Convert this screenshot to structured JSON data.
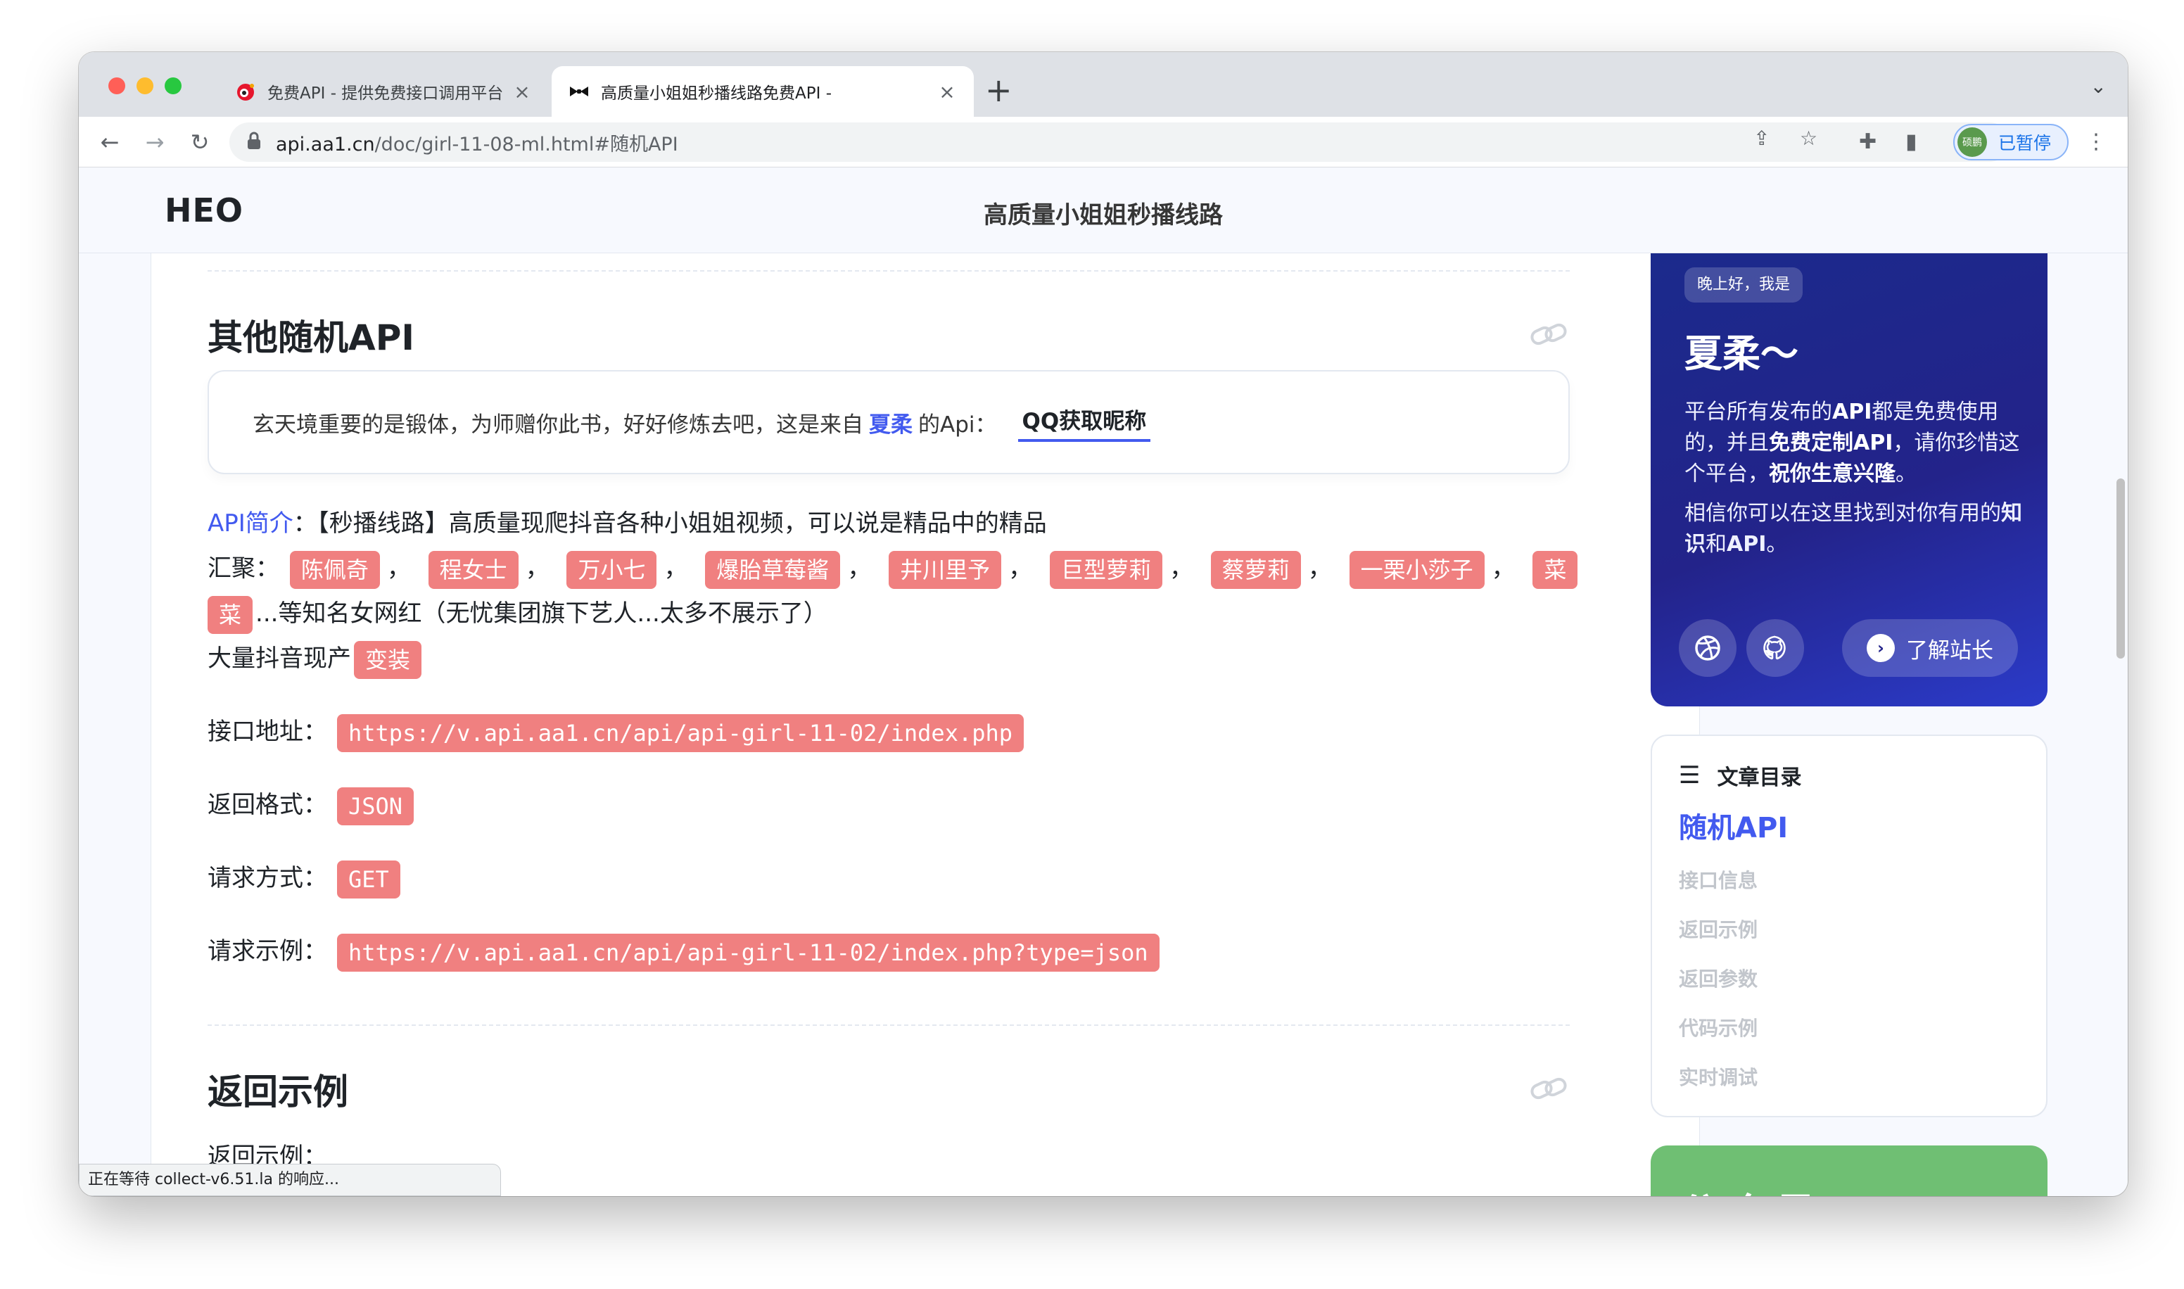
{
  "browser": {
    "tabs": [
      {
        "title": "免费API - 提供免费接口调用平台"
      },
      {
        "title": "高质量小姐姐秒播线路免费API -"
      }
    ],
    "url_host": "api.aa1.cn",
    "url_path": "/doc/girl-11-08-ml.html#随机API",
    "profile_avatar": "硕鹏",
    "profile_label": "已暂停",
    "status_text": "正在等待 collect-v6.51.la 的响应..."
  },
  "site": {
    "logo": "HEO",
    "title": "高质量小姐姐秒播线路"
  },
  "article": {
    "section1_title": "其他随机API",
    "quote": {
      "text": "玄天境重要的是锻体，为师赠你此书，好好修炼去吧，这是来自",
      "author": "夏柔",
      "suffix": "的Api：",
      "link": "QQ获取昵称"
    },
    "intro_label": "API简介",
    "intro_text": "：【秒播线路】高质量现爬抖音各种小姐姐视频，可以说是精品中的精品",
    "gather_label": "汇聚：",
    "tags": [
      "陈佩奇",
      "程女士",
      "万小七",
      "爆胎草莓酱",
      "井川里予",
      "巨型萝莉",
      "蔡萝莉",
      "一栗小莎子",
      "菜"
    ],
    "tag_cont": "菜",
    "gather_suffix": "...等知名女网红（无忧集团旗下艺人...太多不展示了）",
    "many_label": "大量抖音现产",
    "many_tag": "变装",
    "info": [
      {
        "label": "接口地址：",
        "value": "https://v.api.aa1.cn/api/api-girl-11-02/index.php"
      },
      {
        "label": "返回格式：",
        "value": "JSON"
      },
      {
        "label": "请求方式：",
        "value": "GET"
      },
      {
        "label": "请求示例：",
        "value": "https://v.api.aa1.cn/api/api-girl-11-02/index.php?type=json"
      }
    ],
    "section2_title": "返回示例",
    "section2_sub": "返回示例："
  },
  "sidebar": {
    "greet": "晚上好，我是",
    "name": "夏柔～",
    "desc_a": "平台所有发布的",
    "desc_b": "API",
    "desc_c": "都是免费使用的，并且",
    "desc_d": "免费定制API",
    "desc_e": "，请你珍惜这个平台，",
    "desc_f": "祝你生意兴隆",
    "desc_g": "。",
    "desc2_a": "相信你可以在这里找到对你有用的",
    "desc2_b": "知识",
    "desc2_c": "和",
    "desc2_d": "API",
    "desc2_e": "。",
    "about_label": "了解站长",
    "toc_title": "文章目录",
    "toc_active": "随机API",
    "toc_items": [
      "接口信息",
      "返回示例",
      "返回参数",
      "代码示例",
      "实时调试"
    ],
    "green_title": "公众号"
  },
  "colors": {
    "accent": "#425aef",
    "tag": "#f08080",
    "hero": "#23238a"
  }
}
